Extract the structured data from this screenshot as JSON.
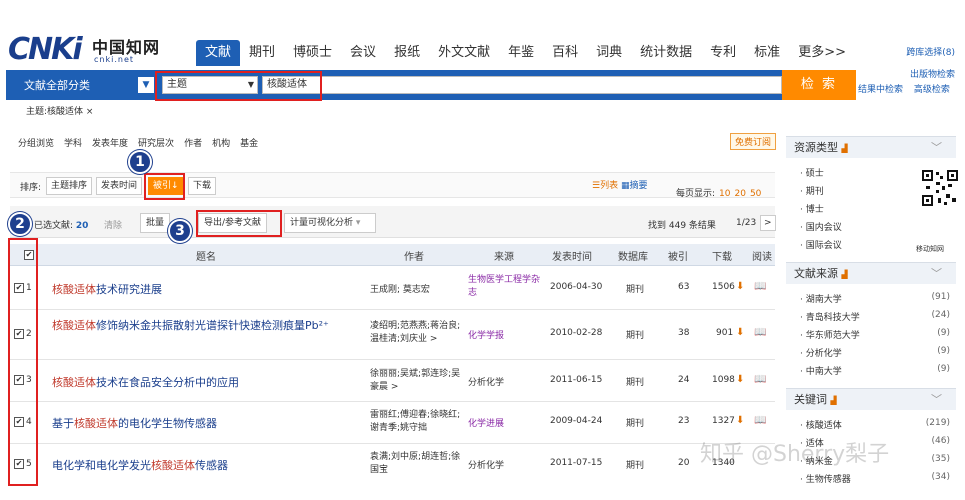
{
  "logo": {
    "big": "CNKi",
    "cn": "中国知网",
    "url": "cnki.net"
  },
  "nav": {
    "items": [
      "文献",
      "期刊",
      "博硕士",
      "会议",
      "报纸",
      "外文文献",
      "年鉴",
      "百科",
      "词典",
      "统计数据",
      "专利",
      "标准",
      "更多>>"
    ]
  },
  "top_links": [
    "跨库选择(8)",
    "出版物检索"
  ],
  "search": {
    "category": "文献全部分类",
    "field": "主题",
    "keyword": "核酸适体",
    "button": "检 索",
    "result_links": [
      "结果中检索",
      "高级检索"
    ]
  },
  "breadcrumb": "主题:核酸适体 ×",
  "filters": [
    "分组浏览",
    "学科",
    "发表年度",
    "研究层次",
    "作者",
    "机构",
    "基金"
  ],
  "subscribe": "免费订阅",
  "sort": {
    "label": "排序:",
    "options": [
      "主题排序",
      "发表时间",
      "被引↓",
      "下载"
    ]
  },
  "views": {
    "list": "☰列表",
    "abstract": "▦摘要"
  },
  "per_page": {
    "label": "每页显示:",
    "options": [
      "10",
      "20",
      "50"
    ]
  },
  "actions": {
    "selected_label": "已选文献:",
    "selected_count": "20",
    "clear": "清除",
    "batch": "批量",
    "export": "导出/参考文献",
    "visual": "计量可视化分析",
    "found": "找到 449 条结果",
    "page": "1/23",
    "next": ">"
  },
  "table": {
    "headers": [
      "题名",
      "作者",
      "来源",
      "发表时间",
      "数据库",
      "被引",
      "下载",
      "阅读"
    ],
    "rows": [
      {
        "num": "1",
        "pre": "",
        "hl": "核酸适体",
        "post": "技术研究进展",
        "authors": "王成刚; 莫志宏",
        "source": "生物医学工程学杂志",
        "date": "2006-04-30",
        "db": "期刊",
        "cited": "63",
        "downloads": "1506"
      },
      {
        "num": "2",
        "pre": "",
        "hl": "核酸适体",
        "post": "修饰纳米金共振散射光谱探针快速检测痕量Pb²⁺",
        "authors": "凌绍明;范燕燕;蒋治良;温桂清;刘庆业 >",
        "source": "化学学报",
        "date": "2010-02-28",
        "db": "期刊",
        "cited": "38",
        "downloads": "901"
      },
      {
        "num": "3",
        "pre": "",
        "hl": "核酸适体",
        "post": "技术在食品安全分析中的应用",
        "authors": "徐丽丽;吴斌;郭连珍;吴豪晨 >",
        "source": "分析化学",
        "date": "2011-06-15",
        "db": "期刊",
        "cited": "24",
        "downloads": "1098"
      },
      {
        "num": "4",
        "pre": "基于",
        "hl": "核酸适体",
        "post": "的电化学生物传感器",
        "authors": "雷丽红;傅迎春;徐晓红;谢青季;姚守拙",
        "source": "化学进展",
        "date": "2009-04-24",
        "db": "期刊",
        "cited": "23",
        "downloads": "1327"
      },
      {
        "num": "5",
        "pre": "电化学和电化学发光",
        "hl": "核酸适体",
        "post": "传感器",
        "authors": "袁满;刘中原;胡连哲;徐国宝",
        "source": "分析化学",
        "date": "2011-07-15",
        "db": "期刊",
        "cited": "20",
        "downloads": "1340"
      }
    ]
  },
  "sidebar": {
    "resource_title": "资源类型",
    "resources": [
      "硕士",
      "期刊",
      "博士",
      "国内会议",
      "国际会议"
    ],
    "source_title": "文献来源",
    "sources": [
      {
        "name": "湖南大学",
        "count": "(91)"
      },
      {
        "name": "青岛科技大学",
        "count": "(24)"
      },
      {
        "name": "华东师范大学",
        "count": "(9)"
      },
      {
        "name": "分析化学",
        "count": "(9)"
      },
      {
        "name": "中南大学",
        "count": "(9)"
      }
    ],
    "keyword_title": "关键词",
    "keywords": [
      {
        "name": "核酸适体",
        "count": "(219)"
      },
      {
        "name": "适体",
        "count": "(46)"
      },
      {
        "name": "纳米金",
        "count": "(35)"
      },
      {
        "name": "生物传感器",
        "count": "(34)"
      }
    ],
    "qr_caption": "移动知网"
  },
  "annotations": [
    "1",
    "2",
    "3"
  ],
  "watermark": "知乎 @Sherry梨子"
}
